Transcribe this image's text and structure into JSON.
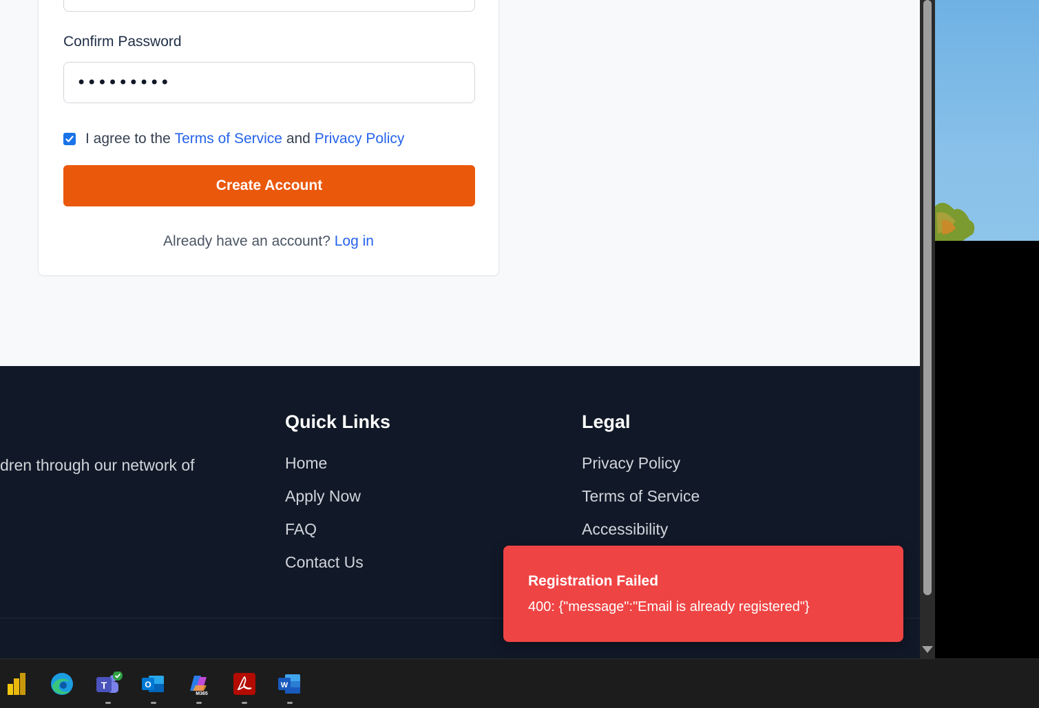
{
  "form": {
    "confirm_password_label": "Confirm Password",
    "confirm_password_value": "•••••••••",
    "agree_checked": true,
    "agree_prefix": "I agree to the",
    "terms_link": "Terms of Service",
    "and_text": "and",
    "privacy_link": "Privacy Policy",
    "create_button": "Create Account",
    "login_prompt": "Already have an account?",
    "login_link": "Log in"
  },
  "footer": {
    "blurb": "dren through our network of",
    "quick_links": {
      "heading": "Quick Links",
      "items": [
        "Home",
        "Apply Now",
        "FAQ",
        "Contact Us"
      ]
    },
    "legal": {
      "heading": "Legal",
      "items": [
        "Privacy Policy",
        "Terms of Service",
        "Accessibility"
      ]
    }
  },
  "toast": {
    "title": "Registration Failed",
    "message": "400: {\"message\":\"Email is already registered\"}"
  },
  "taskbar": {
    "apps": [
      "power-bi-icon",
      "edge-icon",
      "teams-icon",
      "outlook-icon",
      "m365-copilot-icon",
      "acrobat-icon",
      "word-icon"
    ]
  },
  "colors": {
    "accent_orange": "#ea580c",
    "link_blue": "#2563eb",
    "footer_bg": "#111827",
    "toast_red": "#ef4444"
  }
}
